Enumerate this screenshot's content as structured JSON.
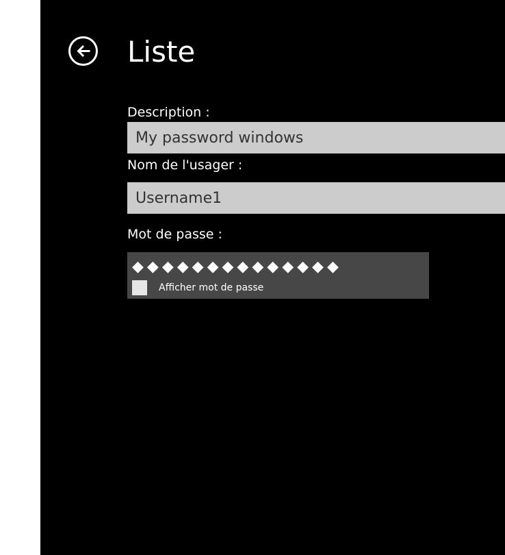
{
  "header": {
    "title": "Liste",
    "back_icon": "back-arrow-circle-icon"
  },
  "form": {
    "description_label": "Description :",
    "description_value": "My password windows",
    "username_label": "Nom de l'usager :",
    "username_value": "Username1",
    "password_label": "Mot de passe :",
    "password_masked": "◆◆◆◆◆◆◆◆◆◆◆◆◆◆",
    "show_password_label": "Afficher mot de passe",
    "show_password_checked": false
  },
  "colors": {
    "background": "#000000",
    "input_background": "#cccccc",
    "password_box_background": "#474747",
    "text": "#ffffff"
  }
}
